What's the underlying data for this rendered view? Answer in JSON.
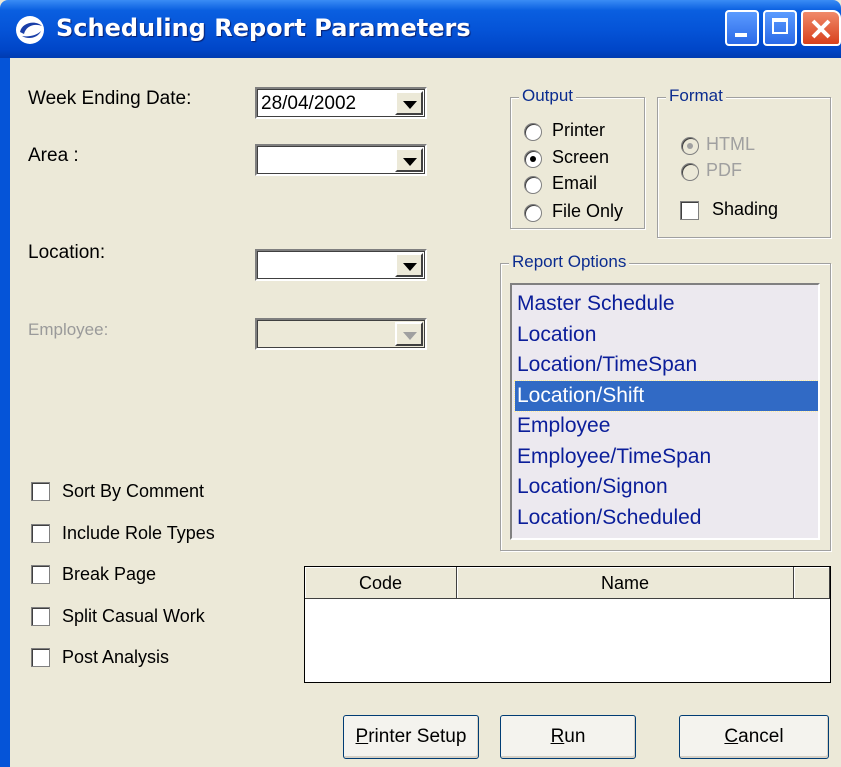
{
  "window": {
    "title": "Scheduling Report Parameters"
  },
  "fields": {
    "week_ending_label": "Week Ending Date:",
    "week_ending_value": "28/04/2002",
    "area_label": "Area :",
    "area_value": "",
    "location_label": "Location:",
    "location_value": "",
    "employee_label": "Employee:",
    "employee_value": ""
  },
  "output": {
    "legend": "Output",
    "options": [
      {
        "label": "Printer",
        "selected": false
      },
      {
        "label": "Screen",
        "selected": true
      },
      {
        "label": "Email",
        "selected": false
      },
      {
        "label": "File Only",
        "selected": false
      }
    ]
  },
  "format": {
    "legend": "Format",
    "options": [
      {
        "label": "HTML",
        "selected": true,
        "enabled": false
      },
      {
        "label": "PDF",
        "selected": false,
        "enabled": false
      }
    ],
    "shading_label": "Shading",
    "shading_checked": false
  },
  "report_options": {
    "legend": "Report Options",
    "items": [
      "Master Schedule",
      "Location",
      "Location/TimeSpan",
      "Location/Shift",
      "Employee",
      "Employee/TimeSpan",
      "Location/Signon",
      "Location/Scheduled"
    ],
    "selected": "Location/Shift"
  },
  "checkboxes": [
    {
      "label": "Sort By Comment",
      "checked": false
    },
    {
      "label": "Include Role Types",
      "checked": false
    },
    {
      "label": "Break Page",
      "checked": false
    },
    {
      "label": "Split Casual Work",
      "checked": false
    },
    {
      "label": "Post Analysis",
      "checked": false
    }
  ],
  "grid": {
    "columns": [
      "Code",
      "Name"
    ],
    "rows": []
  },
  "buttons": {
    "printer_setup": {
      "prefix": "",
      "ul": "P",
      "rest": "rinter Setup"
    },
    "run": {
      "prefix": "",
      "ul": "R",
      "rest": "un"
    },
    "cancel": {
      "prefix": "",
      "ul": "C",
      "rest": "ancel"
    }
  },
  "colors": {
    "title_bar": "#0554d8",
    "selection": "#316ac5",
    "list_text": "#0b1e9a",
    "face": "#ece9d8"
  }
}
